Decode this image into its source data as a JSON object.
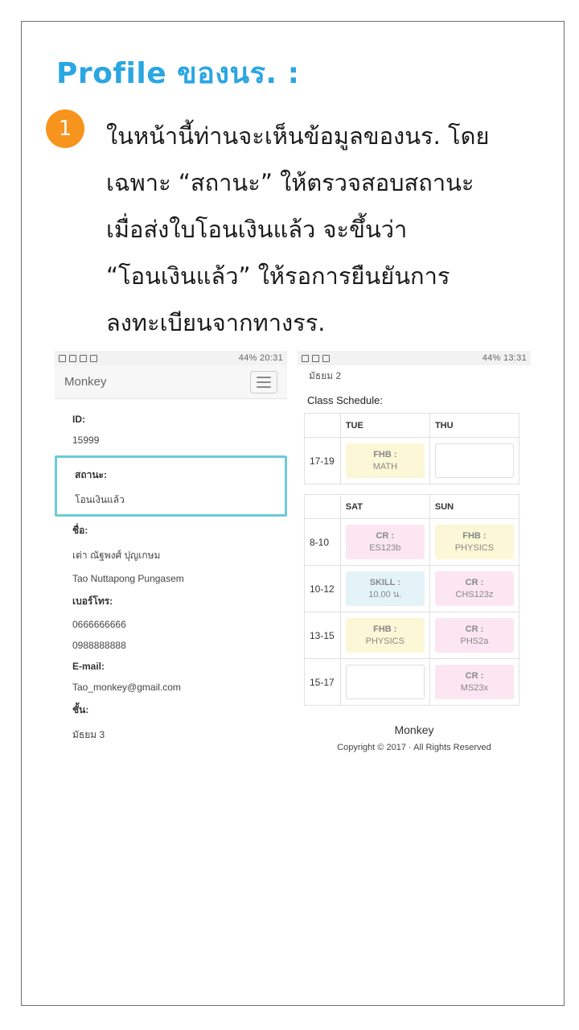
{
  "title": "Profile ของนร. :",
  "step": {
    "number": "1",
    "lines": [
      "ในหน้านี้ท่านจะเห็นข้อมูลของนร. โดย",
      "เฉพาะ “สถานะ” ให้ตรวจสอบสถานะ",
      "เมื่อส่งใบโอนเงินแล้ว จะขึ้นว่า",
      "“โอนเงินแล้ว” ให้รอการยืนยันการ",
      "ลงทะเบียนจากทางรร."
    ]
  },
  "phone_left": {
    "status": "44% 20:31",
    "brand": "Monkey",
    "fields": {
      "id_label": "ID:",
      "id_value": "15999",
      "status_label": "สถานะ:",
      "status_value": "โอนเงินแล้ว",
      "name_label": "ชื่อ:",
      "name_th": "เต่า ณัฐพงศ์ ปุญเกษม",
      "name_en": "Tao Nuttapong Pungasem",
      "phone_label": "เบอร์โทร:",
      "phone_1": "0666666666",
      "phone_2": "0988888888",
      "email_label": "E-mail:",
      "email_value": "Tao_monkey@gmail.com",
      "grade_label": "ชั้น:",
      "grade_value": "มัธยม 3"
    }
  },
  "phone_right": {
    "status": "44% 13:31",
    "grade": "มัธยม 2",
    "schedule_title": "Class Schedule:",
    "table1": {
      "headers": [
        "TUE",
        "THU"
      ],
      "rows": [
        {
          "time": "17-19",
          "a_title": "FHB :",
          "a_sub": "MATH"
        }
      ]
    },
    "table2": {
      "headers": [
        "SAT",
        "SUN"
      ],
      "rows": [
        {
          "time": "8-10",
          "a_title": "CR :",
          "a_sub": "ES123b",
          "b_title": "FHB :",
          "b_sub": "PHYSICS"
        },
        {
          "time": "10-12",
          "a_title": "SKILL :",
          "a_sub": "10.00 น.",
          "b_title": "CR :",
          "b_sub": "CHS123z"
        },
        {
          "time": "13-15",
          "a_title": "FHB :",
          "a_sub": "PHYSICS",
          "b_title": "CR :",
          "b_sub": "PHS2a"
        },
        {
          "time": "15-17",
          "b_title": "CR :",
          "b_sub": "MS23x"
        }
      ]
    },
    "footer_brand": "Monkey",
    "footer_copy": "Copyright © 2017 · All Rights Reserved"
  }
}
